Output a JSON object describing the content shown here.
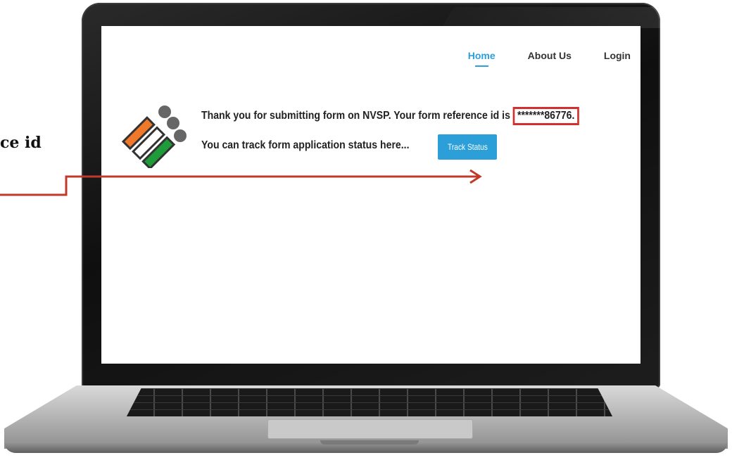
{
  "callout": {
    "text": "ce id"
  },
  "nav": {
    "items": [
      {
        "label": "Home",
        "active": true
      },
      {
        "label": "About Us",
        "active": false
      },
      {
        "label": "Login",
        "active": false
      }
    ]
  },
  "message": {
    "line1": "Thank you for submitting form on NVSP. Your form reference id is ",
    "reference_id": "*******86776.",
    "line2": "You can track form application status here..."
  },
  "actions": {
    "track_status_label": "Track Status"
  },
  "colors": {
    "accent": "#2c9fd9",
    "highlight": "#d32f2f",
    "arrow": "#c0392b",
    "logo_orange": "#f0782a",
    "logo_green": "#1f9c3a"
  },
  "icons": {
    "logo": "ballot-voter-logo-icon"
  }
}
